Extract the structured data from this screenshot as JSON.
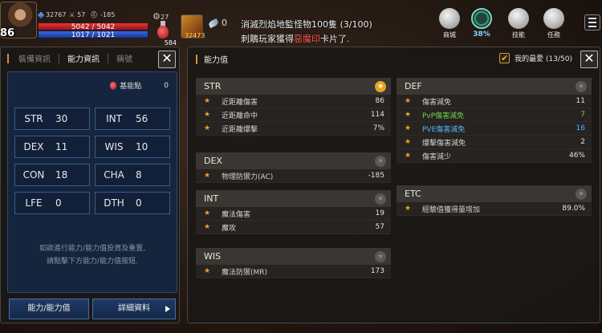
{
  "hud": {
    "level": "86",
    "gems": "32767",
    "attack": "57",
    "defense": "-185",
    "hp_text": "5042 / 5042",
    "mp_text": "1017 / 1021",
    "potion_count": "584",
    "buff_count": "27",
    "skill_count": "32473",
    "quick_count": "0",
    "notice_line1": "消滅烈焰地監怪物100隻 (3/100)",
    "notice_line2_prefix": "刺鵰玩家獲得",
    "notice_line2_highlight": "惡魔印",
    "notice_line2_suffix": "卡片了.",
    "menu": {
      "shop": "商城",
      "gauge_pct": "38%",
      "skills": "技能",
      "quests": "任務"
    }
  },
  "left_panel": {
    "tabs": [
      "裝備資訊",
      "能力資訊",
      "稱號"
    ],
    "active_tab": 1,
    "basic_points_label": "基能點",
    "basic_points_value": "0",
    "stats": [
      {
        "k": "STR",
        "v": "30"
      },
      {
        "k": "INT",
        "v": "56"
      },
      {
        "k": "DEX",
        "v": "11"
      },
      {
        "k": "WIS",
        "v": "10"
      },
      {
        "k": "CON",
        "v": "18"
      },
      {
        "k": "CHA",
        "v": "8"
      },
      {
        "k": "LFE",
        "v": "0"
      },
      {
        "k": "DTH",
        "v": "0"
      }
    ],
    "hint_line1": "如欲進行能力/能力值投資及重置,",
    "hint_line2": "請點擊下方能力/能力值按鈕.",
    "btn_ability": "能力/能力值",
    "btn_detail": "詳細資料"
  },
  "right_panel": {
    "title": "能力值",
    "favorites": "我的最愛 (13/50)",
    "groups": {
      "str": {
        "title": "STR",
        "rows": [
          {
            "name": "近距離傷害",
            "value": "86"
          },
          {
            "name": "近距離命中",
            "value": "114"
          },
          {
            "name": "近距離爆擊",
            "value": "7%"
          }
        ]
      },
      "dex": {
        "title": "DEX",
        "rows": [
          {
            "name": "物理防禦力(AC)",
            "value": "-185"
          }
        ]
      },
      "int": {
        "title": "INT",
        "rows": [
          {
            "name": "魔法傷害",
            "value": "19"
          },
          {
            "name": "魔攻",
            "value": "57"
          }
        ]
      },
      "wis": {
        "title": "WIS",
        "rows": [
          {
            "name": "魔法防禦(MR)",
            "value": "173"
          }
        ]
      },
      "def": {
        "title": "DEF",
        "rows": [
          {
            "name": "傷害減免",
            "value": "11"
          },
          {
            "name": "PvP傷害減免",
            "value": "7"
          },
          {
            "name": "PVE傷害減免",
            "value": "16"
          },
          {
            "name": "爆擊傷害減免",
            "value": "2"
          },
          {
            "name": "傷害減少",
            "value": "46%"
          }
        ]
      },
      "etc": {
        "title": "ETC",
        "rows": [
          {
            "name": "經驗值獲得量增加",
            "value": "89.0%"
          }
        ]
      }
    }
  },
  "colors": {
    "star": "#e7a32a",
    "pvp": "#75d04a",
    "pve": "#58b4ff",
    "stat_panel_bg": "#14253d"
  }
}
